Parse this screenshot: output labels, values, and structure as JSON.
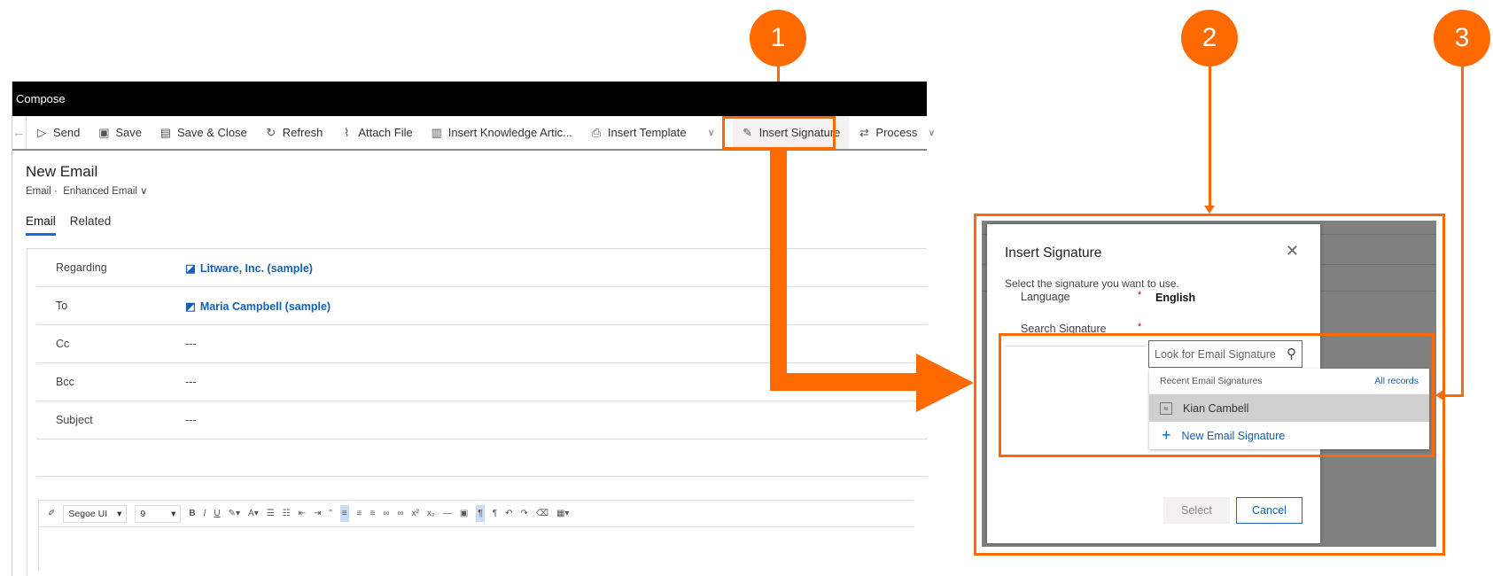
{
  "callouts": [
    "1",
    "2",
    "3"
  ],
  "window": {
    "title": "Compose"
  },
  "toolbar": {
    "back_icon": "arrow-left-icon",
    "items": [
      {
        "label": "Send",
        "icon": "send-icon"
      },
      {
        "label": "Save",
        "icon": "save-icon"
      },
      {
        "label": "Save & Close",
        "icon": "save-close-icon"
      },
      {
        "label": "Refresh",
        "icon": "refresh-icon"
      },
      {
        "label": "Attach File",
        "icon": "paperclip-icon"
      },
      {
        "label": "Insert Knowledge Artic...",
        "icon": "book-icon"
      },
      {
        "label": "Insert Template",
        "icon": "template-icon"
      },
      {
        "label": "Insert Signature",
        "icon": "signature-icon"
      },
      {
        "label": "Process",
        "icon": "process-icon"
      }
    ]
  },
  "header": {
    "title": "New Email",
    "entity": "Email",
    "separator": "·",
    "form": "Enhanced Email"
  },
  "tabs": [
    {
      "label": "Email",
      "active": true
    },
    {
      "label": "Related",
      "active": false
    }
  ],
  "fields": [
    {
      "label": "Regarding",
      "value": "Litware, Inc. (sample)",
      "link": true
    },
    {
      "label": "To",
      "value": "Maria Campbell (sample)",
      "link": true
    },
    {
      "label": "Cc",
      "value": "---"
    },
    {
      "label": "Bcc",
      "value": "---"
    },
    {
      "label": "Subject",
      "value": "---"
    }
  ],
  "editor": {
    "font": "Segoe UI",
    "size": "9"
  },
  "dialog": {
    "title": "Insert Signature",
    "subtitle": "Select the signature you want to use.",
    "language_label": "Language",
    "language_value": "English",
    "search_label": "Search Signature",
    "required": "*",
    "search_placeholder": "Look for Email Signature",
    "dropdown": {
      "header": "Recent Email Signatures",
      "all_records": "All records",
      "items": [
        "Kian Cambell"
      ],
      "new_label": "New Email Signature"
    },
    "select_label": "Select",
    "cancel_label": "Cancel"
  },
  "colors": {
    "accent": "#ff6a00",
    "link": "#1160b7"
  }
}
